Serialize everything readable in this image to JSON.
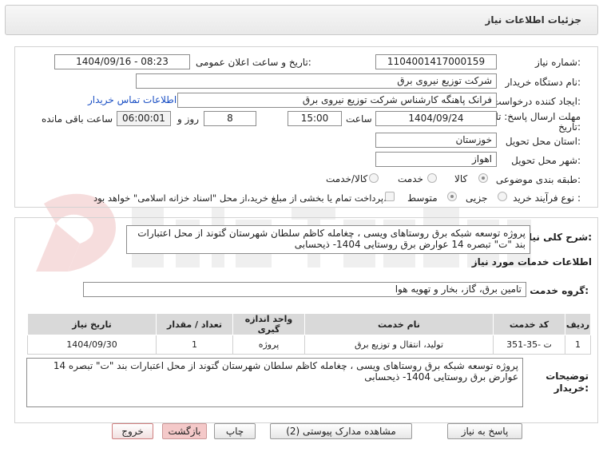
{
  "header": {
    "title": "جزئیات اطلاعات نیاز"
  },
  "form": {
    "need_number_label": "شماره نیاز:",
    "need_number": "1104001417000159",
    "announce_label": "تاریخ و ساعت اعلان عمومی:",
    "announce_value": "1404/09/16 - 08:23",
    "buyer_org_label": "نام دستگاه خریدار:",
    "buyer_org": "شرکت توزیع نیروی برق",
    "creator_label": "ایجاد کننده درخواست:",
    "creator": "فرانک  پاهنگه کارشناس  شرکت توزیع نیروی برق",
    "contact_link": "اطلاعات تماس خریدار",
    "deadline_label_1": "مهلت ارسال پاسخ: تا",
    "deadline_label_2": "تاریخ:",
    "deadline_date": "1404/09/24",
    "time_label": "ساعت",
    "deadline_time": "15:00",
    "days_value": "8",
    "days_label": "روز و",
    "remaining_time": "06:00:01",
    "remaining_label": "ساعت باقی مانده",
    "province_label": "استان محل تحویل:",
    "province": "خوزستان",
    "city_label": "شهر محل تحویل:",
    "city": "اهواز",
    "category_label": "طبقه بندی موضوعی:",
    "category_options": [
      "کالا",
      "خدمت",
      "کالا/خدمت"
    ],
    "category_selected": "کالا",
    "process_label": "نوع فرآیند خرید :",
    "process_options": [
      "جزیی",
      "متوسط"
    ],
    "process_selected": "جزیی",
    "payment_note": "پرداخت تمام یا بخشی از مبلغ خرید،از محل \"اسناد خزانه اسلامی\" خواهد بود."
  },
  "summary": {
    "label": "شرح کلی نیاز:",
    "text": "پروژه توسعه شبکه برق روستاهای ویسی ، چغامله کاظم سلطان  شهرستان گتوند از محل اعتبارات بند \"ت\" تبصره 14 عوارض برق روستایی 1404- ذیحسابی"
  },
  "services": {
    "section_title": "اطلاعات خدمات مورد نیاز",
    "group_label": "گروه خدمت:",
    "group_value": "تامین برق، گاز، بخار و تهویه هوا",
    "columns": [
      "ردیف",
      "کد خدمت",
      "نام خدمت",
      "واحد اندازه گیری",
      "تعداد / مقدار",
      "تاریخ نیاز"
    ],
    "rows": [
      [
        "1",
        "ت -35-351",
        "تولید، انتقال و توزیع برق",
        "پروژه",
        "1",
        "1404/09/30"
      ]
    ]
  },
  "buyer_notes": {
    "label_1": "توضیحات",
    "label_2": "خریدار:",
    "text": "پروژه توسعه شبکه برق روستاهای ویسی ، چغامله کاظم سلطان  شهرستان گتوند از محل اعتبارات بند \"ت\" تبصره 14 عوارض برق روستایی 1404- ذیحسابی"
  },
  "buttons": {
    "reply": "پاسخ به نیاز",
    "attachments": "مشاهده مدارک پیوستی (2)",
    "print": "چاپ",
    "back": "بازگشت",
    "exit": "خروج"
  },
  "colors": {
    "link": "#1a4fc4",
    "header_bg": "#ececec",
    "table_header": "#d9d9d9",
    "back_button": "#f4c9c9"
  }
}
